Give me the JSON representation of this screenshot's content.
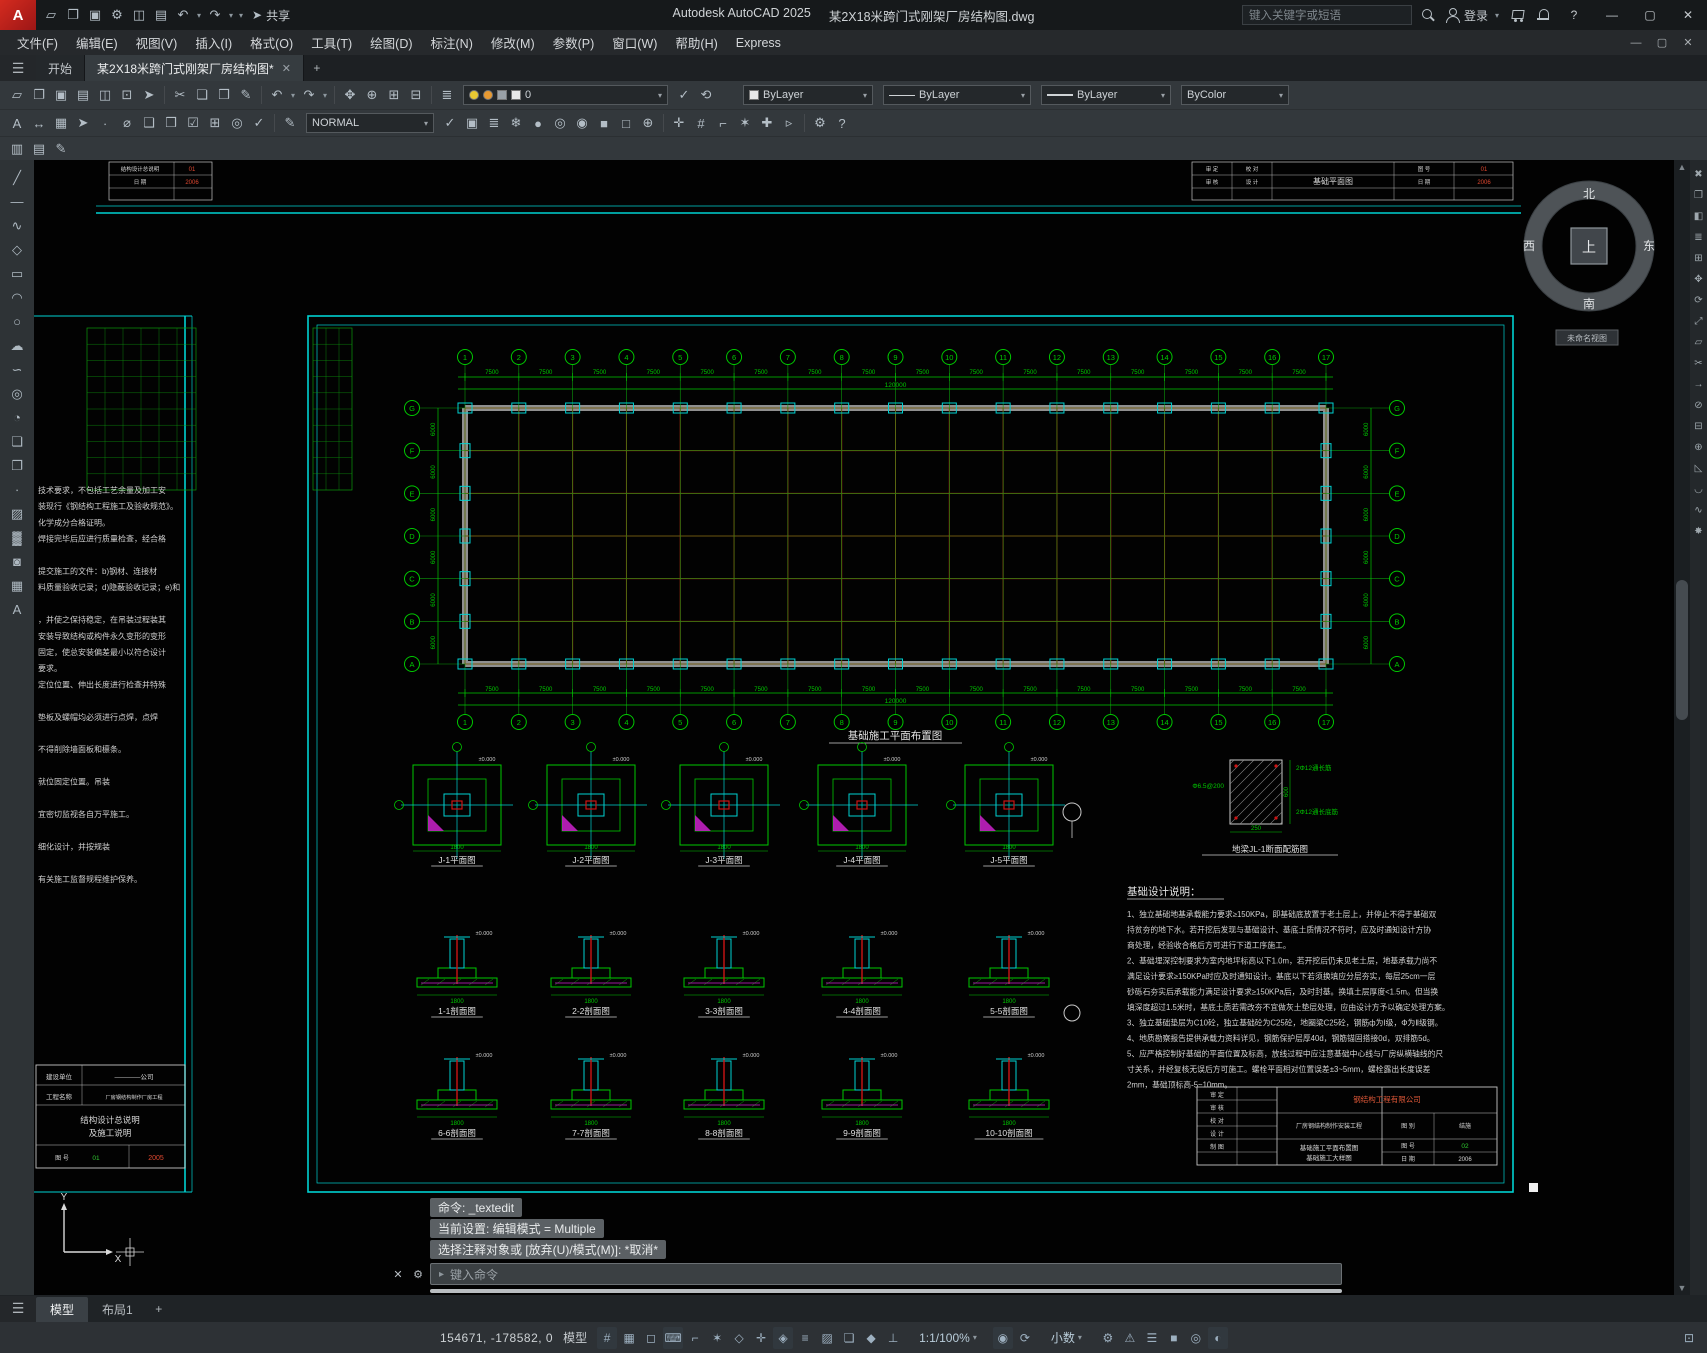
{
  "titlebar": {
    "app_title": "Autodesk AutoCAD 2025",
    "doc_title": "某2X18米跨门式刚架厂房结构图.dwg",
    "share_label": "共享",
    "search_placeholder": "键入关键字或短语",
    "login_label": "登录",
    "qat": [
      {
        "n": "qnew",
        "g": "▱"
      },
      {
        "n": "open",
        "g": "❐"
      },
      {
        "n": "save",
        "g": "▣"
      },
      {
        "n": "workspace",
        "g": "⚙"
      },
      {
        "n": "plot",
        "g": "◫"
      },
      {
        "n": "sheet-set",
        "g": "▤"
      },
      {
        "n": "undo",
        "g": "↶"
      },
      {
        "n": "undo-menu",
        "g": "▾"
      },
      {
        "n": "redo",
        "g": "↷"
      },
      {
        "n": "redo-menu",
        "g": "▾"
      },
      {
        "n": "qat-menu",
        "g": "▾"
      }
    ]
  },
  "menubar": {
    "items": [
      "文件(F)",
      "编辑(E)",
      "视图(V)",
      "插入(I)",
      "格式(O)",
      "工具(T)",
      "绘图(D)",
      "标注(N)",
      "修改(M)",
      "参数(P)",
      "窗口(W)",
      "帮助(H)",
      "Express"
    ]
  },
  "tabs": {
    "start": "开始",
    "doc": "某2X18米跨门式刚架厂房结构图*"
  },
  "ribbon": {
    "style_combo": "NORMAL",
    "layer_value": "0",
    "color_value": "ByLayer",
    "linetype_value": "ByLayer",
    "lineweight_value": "ByLayer",
    "plotstyle_value": "ByColor",
    "row1_icons": [
      {
        "n": "qnew",
        "g": "▱"
      },
      {
        "n": "open",
        "g": "❐"
      },
      {
        "n": "save",
        "g": "▣"
      },
      {
        "n": "save-as",
        "g": "▤"
      },
      {
        "n": "plot",
        "g": "◫"
      },
      {
        "n": "plot-preview",
        "g": "⊡"
      },
      {
        "n": "publish",
        "g": "➤"
      },
      {
        "n": "sep"
      },
      {
        "n": "cut",
        "g": "✂"
      },
      {
        "n": "copy-clip",
        "g": "❏"
      },
      {
        "n": "paste",
        "g": "❒"
      },
      {
        "n": "match-properties",
        "g": "✎"
      },
      {
        "n": "sep"
      },
      {
        "n": "undo",
        "g": "↶"
      },
      {
        "n": "undo-menu",
        "g": "▾"
      },
      {
        "n": "redo",
        "g": "↷"
      },
      {
        "n": "redo-menu",
        "g": "▾"
      },
      {
        "n": "sep"
      },
      {
        "n": "pan",
        "g": "✥"
      },
      {
        "n": "zoom-realtime",
        "g": "⊕"
      },
      {
        "n": "zoom-window",
        "g": "⊞"
      },
      {
        "n": "zoom-previous",
        "g": "⊟"
      },
      {
        "n": "sep"
      },
      {
        "n": "layer-properties",
        "g": "≣"
      }
    ],
    "row1_icons_b": [
      {
        "n": "make-object-layer-current",
        "g": "✓"
      },
      {
        "n": "layer-previous",
        "g": "⟲"
      }
    ],
    "row2_icons_a": [
      {
        "n": "text-style",
        "g": "A"
      },
      {
        "n": "dimension-style",
        "g": "↔"
      },
      {
        "n": "table-style",
        "g": "▦"
      },
      {
        "n": "multileader-style",
        "g": "➤"
      },
      {
        "n": "point-style",
        "g": "∙"
      },
      {
        "n": "units-dialog",
        "g": "⌀"
      },
      {
        "n": "group",
        "g": "❑"
      },
      {
        "n": "ungroup",
        "g": "❒"
      },
      {
        "n": "quick-select",
        "g": "☑"
      },
      {
        "n": "quick-calc",
        "g": "⊞"
      },
      {
        "n": "find-replace",
        "g": "◎"
      },
      {
        "n": "spell-check",
        "g": "✓"
      },
      {
        "n": "sep"
      },
      {
        "n": "style-edit",
        "g": "✎"
      }
    ],
    "row2_icons_b": [
      {
        "n": "set-current-style",
        "g": "✓"
      },
      {
        "n": "style-manager",
        "g": "▣"
      },
      {
        "n": "layer-states",
        "g": "≣"
      },
      {
        "n": "layer-freeze",
        "g": "❄"
      },
      {
        "n": "layer-off",
        "g": "●"
      },
      {
        "n": "layer-isolate",
        "g": "◎"
      },
      {
        "n": "layer-unisolate",
        "g": "◉"
      },
      {
        "n": "layer-lock",
        "g": "■"
      },
      {
        "n": "layer-unlock",
        "g": "□"
      },
      {
        "n": "layer-merge",
        "g": "⊕"
      },
      {
        "n": "sep"
      },
      {
        "n": "osnap-settings",
        "g": "✛"
      },
      {
        "n": "grid-settings",
        "g": "#"
      },
      {
        "n": "ortho-toggle",
        "g": "⌐"
      },
      {
        "n": "polar-toggle",
        "g": "✶"
      },
      {
        "n": "otrack-toggle",
        "g": "✚"
      },
      {
        "n": "dyn-input-toggle",
        "g": "▹"
      },
      {
        "n": "sep"
      },
      {
        "n": "cui-settings",
        "g": "⚙"
      },
      {
        "n": "ribbon-help",
        "g": "?"
      }
    ],
    "row3_icons": [
      {
        "n": "tool-palettes",
        "g": "▥"
      },
      {
        "n": "properties-palette",
        "g": "▤"
      },
      {
        "n": "markup-assist",
        "g": "✎"
      }
    ]
  },
  "palettes": {
    "left": [
      {
        "n": "line",
        "g": "╱"
      },
      {
        "n": "construction-line",
        "g": "—"
      },
      {
        "n": "polyline",
        "g": "∿"
      },
      {
        "n": "polygon",
        "g": "◇"
      },
      {
        "n": "rectangle",
        "g": "▭"
      },
      {
        "n": "arc",
        "g": "◠"
      },
      {
        "n": "circle",
        "g": "○"
      },
      {
        "n": "revision-cloud",
        "g": "☁"
      },
      {
        "n": "spline",
        "g": "∽"
      },
      {
        "n": "ellipse",
        "g": "◎"
      },
      {
        "n": "ellipse-arc",
        "g": "◔"
      },
      {
        "n": "insert-block",
        "g": "❏"
      },
      {
        "n": "make-block",
        "g": "❐"
      },
      {
        "n": "point",
        "g": "∙"
      },
      {
        "n": "hatch",
        "g": "▨"
      },
      {
        "n": "gradient",
        "g": "▓"
      },
      {
        "n": "region",
        "g": "◙"
      },
      {
        "n": "table",
        "g": "▦"
      },
      {
        "n": "multiline-text",
        "g": "A"
      }
    ],
    "right": [
      {
        "n": "erase",
        "g": "✖"
      },
      {
        "n": "copy",
        "g": "❐"
      },
      {
        "n": "mirror",
        "g": "◧"
      },
      {
        "n": "offset",
        "g": "≣"
      },
      {
        "n": "array",
        "g": "⊞"
      },
      {
        "n": "move",
        "g": "✥"
      },
      {
        "n": "rotate",
        "g": "⟳"
      },
      {
        "n": "scale",
        "g": "⤢"
      },
      {
        "n": "stretch",
        "g": "▱"
      },
      {
        "n": "trim",
        "g": "✂"
      },
      {
        "n": "extend",
        "g": "→"
      },
      {
        "n": "break-at-point",
        "g": "⊘"
      },
      {
        "n": "break",
        "g": "⊟"
      },
      {
        "n": "join",
        "g": "⊕"
      },
      {
        "n": "chamfer",
        "g": "◺"
      },
      {
        "n": "fillet",
        "g": "◡"
      },
      {
        "n": "blend-curves",
        "g": "∿"
      },
      {
        "n": "explode",
        "g": "✸"
      }
    ]
  },
  "plan": {
    "title": "基础施工平面布置图",
    "columns": [
      "1",
      "2",
      "3",
      "4",
      "5",
      "6",
      "7",
      "8",
      "9",
      "10",
      "11",
      "12",
      "13",
      "14",
      "15",
      "16",
      "17"
    ],
    "rows": [
      "G",
      "F",
      "E",
      "D",
      "C",
      "B",
      "A"
    ],
    "bay_dim": "7500",
    "total_dim": "120000",
    "side_dim": "6000"
  },
  "details": {
    "plans": [
      "J-1平面图",
      "J-2平面图",
      "J-3平面图",
      "J-4平面图",
      "J-5平面图"
    ],
    "sections_row1": [
      "1-1剖面图",
      "2-2剖面图",
      "3-3剖面图",
      "4-4剖面图",
      "5-5剖面图"
    ],
    "sections_row2": [
      "6-6剖面图",
      "7-7剖面图",
      "8-8剖面图",
      "9-9剖面图",
      "10-10剖面图"
    ],
    "dim_label": "1800",
    "elev_label": "±0.000"
  },
  "beam_detail": {
    "label": "地梁JL-1断面配筋图",
    "stirrup": "Φ6.5@200",
    "top_bars": "2Φ12通长筋",
    "bottom_bars": "2Φ12通长底筋",
    "width_dim": "250",
    "height_dim": "600"
  },
  "notes_right": {
    "title": "基础设计说明：",
    "lines": [
      "1、独立基础地基承载能力要求≥150KPa，即基础底放置于老土层上，并停止不得于基础双",
      "    持贫夯的地下水。若开挖后发现与基础设计、基底土质情况不符时，应及时通知设计方协",
      "    商处理，经验收合格后方可进行下道工序施工。",
      "2、基础埋深控制要求为室内地坪标高以下1.0m，若开挖后仍未见老土层，地基承载力尚不",
      "    满足设计要求≥150KPa时应及时通知设计。基底以下若须换填应分层夯实，每层25cm一层",
      "    砂砾石夯实后承载能力满足设计要求≥150KPa后，及时封基。换填土层厚度<1.5m。但当换",
      "    填深度超过1.5米时，基底土质若需改夯不宜做灰土垫层处理，应由设计方予以确定处理方案。",
      "3、独立基础垫层为C10砼，独立基础砼为C25砼，地圈梁C25砼，钢筋ф为Ⅰ级，Φ为Ⅱ级钢。",
      "4、地质勘察报告提供承载力资料详见，钢筋保护层厚40d，钢筋锚固搭接0d，双排筋5d。",
      "5、应严格控制好基础的平面位置及标高，放线过程中应注意基础中心线与厂房纵横轴线的尺",
      "    寸关系，并经复核无误后方可施工。螺栓平面相对位置误差±3~5mm，螺栓露出长度误差",
      "    2mm，基础顶标高-5~10mm。"
    ]
  },
  "notes_left": {
    "lines": [
      "技术要求，不包括工艺余量及加工安",
      "装现行《钢结构工程施工及验收规范》。",
      "化学成分合格证明。",
      "焊接完毕后应进行质量检查，经合格",
      "",
      "提交施工的文件：b)钢材、连接材",
      "料质量验收记录；d)隐蔽验收记录；e)和",
      "",
      "，并使之保持稳定，在吊装过程装其",
      "安装导致结构或构件永久变形的变形",
      "固定，使总安装偏差最小以符合设计",
      "要求。",
      "定位位置、伸出长度进行检查并特殊",
      "",
      "垫板及螺帽均必须进行点焊，点焊",
      "",
      "不得削除墙面板和檩条。",
      "",
      "就位固定位置。吊装",
      "",
      "宜密切监视各自万平施工。",
      "",
      "细化设计，并按规装",
      "",
      "有关施工监督规程维护保养。"
    ]
  },
  "title_block_left": {
    "owner_label": "建设单位",
    "owner": "————公司",
    "project_label": "工程名称",
    "project": "厂房钢结构制作厂房工程",
    "main_title": "结构设计总说明",
    "main_title2": "及施工说明",
    "fig_label": "图 号",
    "fig_no": "01",
    "date": "2005"
  },
  "title_block_right": {
    "roles": [
      "审 定",
      "审 核",
      "校 对",
      "设 计",
      "制 图"
    ],
    "company": "钢结构工程有限公司",
    "project": "厂房钢结构制作安装工程",
    "drawing_title1": "基础施工平面布置图",
    "drawing_title2": "基础施工大样图",
    "fig_type_label": "图 别",
    "fig_type": "结施",
    "fig_no_label": "图 号",
    "fig_no": "02",
    "date_label": "日 期",
    "date": "2006"
  },
  "table_top_left": {
    "r1": "结构设计总说明",
    "r1v": "01",
    "r2": "日 期",
    "r2v": "2006"
  },
  "table_top_right": {
    "roles": [
      "审 定",
      "审 核",
      "校 对",
      "设 计"
    ],
    "title": "基础平面图",
    "no_label": "图 号",
    "no_val": "01",
    "date_label": "日 期",
    "date_val": "2006"
  },
  "canvas": {
    "compass": {
      "n": "北",
      "s": "南",
      "w": "西",
      "e": "东",
      "center": "上",
      "view_label": "未命名视图"
    },
    "ucs_x": "X",
    "ucs_y": "Y"
  },
  "command": {
    "lines": [
      "命令: _textedit",
      "当前设置: 编辑模式 = Multiple",
      "选择注释对象或 [放弃(U)/模式(M)]: *取消*"
    ],
    "input_placeholder": "键入命令"
  },
  "layout_tabs": {
    "model": "模型",
    "layout1": "布局1"
  },
  "statusbar": {
    "coords": "154671, -178582, 0",
    "model_label": "模型",
    "scale_label": "1:1/100%",
    "units_label": "小数",
    "icons1": [
      {
        "n": "grid",
        "g": "#",
        "a": 1
      },
      {
        "n": "snap-mode",
        "g": "▦",
        "a": 0
      },
      {
        "n": "infer-constraints",
        "g": "◻",
        "a": 0
      },
      {
        "n": "dynamic-input",
        "g": "⌨",
        "a": 1
      },
      {
        "n": "ortho",
        "g": "⌐",
        "a": 0
      },
      {
        "n": "polar-tracking",
        "g": "✶",
        "a": 0
      },
      {
        "n": "isometric-drafting",
        "g": "◇",
        "a": 0
      },
      {
        "n": "object-snap-tracking",
        "g": "✛",
        "a": 0
      },
      {
        "n": "object-snap",
        "g": "◈",
        "a": 1
      },
      {
        "n": "lineweight",
        "g": "≡",
        "a": 0
      },
      {
        "n": "transparency",
        "g": "▨",
        "a": 0
      },
      {
        "n": "selection-cycling",
        "g": "❏",
        "a": 0
      },
      {
        "n": "3d-object-snap",
        "g": "◆",
        "a": 0
      },
      {
        "n": "dynamic-ucs",
        "g": "⊥",
        "a": 0
      }
    ],
    "icons2": [
      {
        "n": "annotation-visibility",
        "g": "◉",
        "a": 1
      },
      {
        "n": "autoscale",
        "g": "⟳",
        "a": 0
      }
    ],
    "icons3": [
      {
        "n": "workspace-switching",
        "g": "⚙",
        "a": 0
      },
      {
        "n": "annotation-monitor",
        "g": "⚠",
        "a": 0
      },
      {
        "n": "quick-properties",
        "g": "☰",
        "a": 0
      },
      {
        "n": "lock-ui",
        "g": "■",
        "a": 0
      },
      {
        "n": "isolate-objects",
        "g": "◎",
        "a": 0
      },
      {
        "n": "graphics-performance",
        "g": "◐",
        "a": 1
      }
    ],
    "icons4": [
      {
        "n": "clean-screen",
        "g": "⊡",
        "a": 0
      }
    ]
  }
}
